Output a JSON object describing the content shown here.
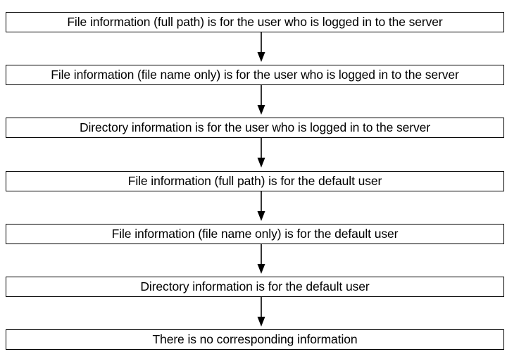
{
  "steps": [
    "File information (full path) is for the user who is logged in to the server",
    "File information (file name only) is for the user who is logged in to the server",
    "Directory information is for the user who is logged in to the server",
    "File information (full path) is for the default user",
    "File information (file name only) is for the default user",
    "Directory information is for the default user",
    "There is no corresponding information"
  ]
}
